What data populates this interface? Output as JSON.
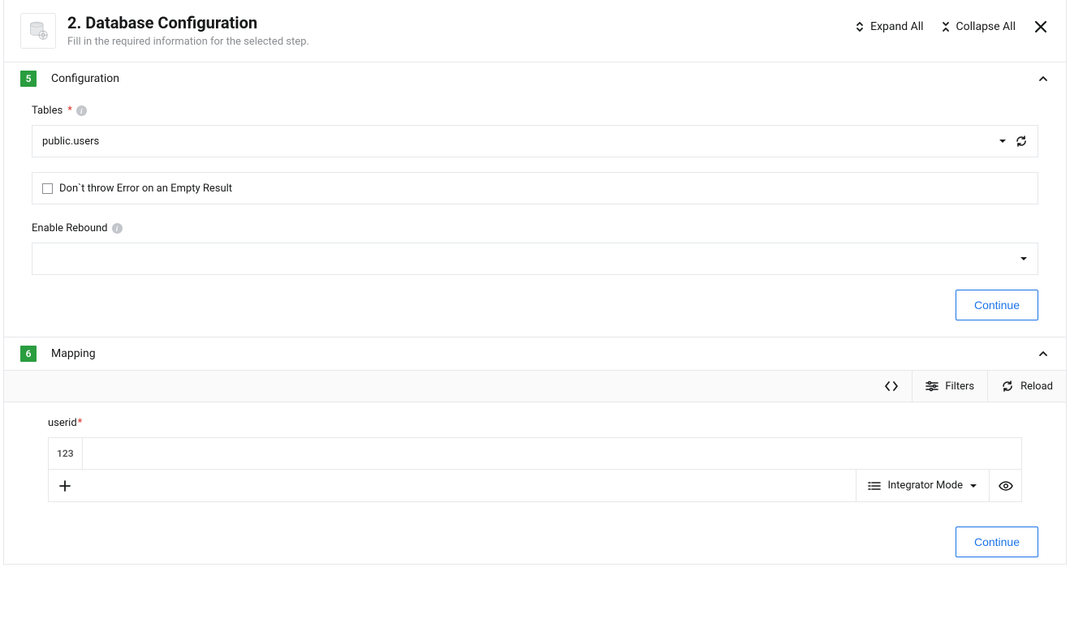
{
  "header": {
    "title": "2. Database Configuration",
    "subtitle": "Fill in the required information for the selected step.",
    "expand_label": "Expand All",
    "collapse_label": "Collapse All"
  },
  "sections": {
    "configuration": {
      "number": "5",
      "title": "Configuration",
      "tables_label": "Tables",
      "tables_value": "public.users",
      "dont_throw_label": "Don`t throw Error on an Empty Result",
      "rebound_label": "Enable Rebound",
      "rebound_value": "",
      "continue_label": "Continue"
    },
    "mapping": {
      "number": "6",
      "title": "Mapping",
      "filters_label": "Filters",
      "reload_label": "Reload",
      "field_label": "userid",
      "field_prefix": "123",
      "field_value": "",
      "mode_label": "Integrator Mode",
      "continue_label": "Continue"
    }
  }
}
